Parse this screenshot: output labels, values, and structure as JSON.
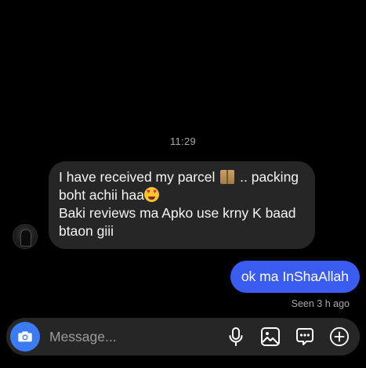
{
  "thread": {
    "timestamp": "11:29",
    "incoming": {
      "line1_a": "I have received my parcel ",
      "line1_b": " .. packing",
      "line2": "boht achii haa",
      "line3": "Baki reviews ma Apko use krny K baad",
      "line4": "btaon giii",
      "emoji1": "package-emoji",
      "emoji2": "heart-eyes-emoji"
    },
    "outgoing": {
      "text": "ok ma InShaAllah"
    },
    "seen_status": "Seen 3 h ago"
  },
  "composer": {
    "placeholder": "Message...",
    "icons": [
      "camera-icon",
      "microphone-icon",
      "image-icon",
      "sticker-icon",
      "plus-icon"
    ]
  },
  "colors": {
    "background": "#000000",
    "incoming_bubble": "#262626",
    "outgoing_bubble": "#3b5cf0",
    "camera_button": "#3b7bf6",
    "muted_text": "#a8a8a8"
  }
}
